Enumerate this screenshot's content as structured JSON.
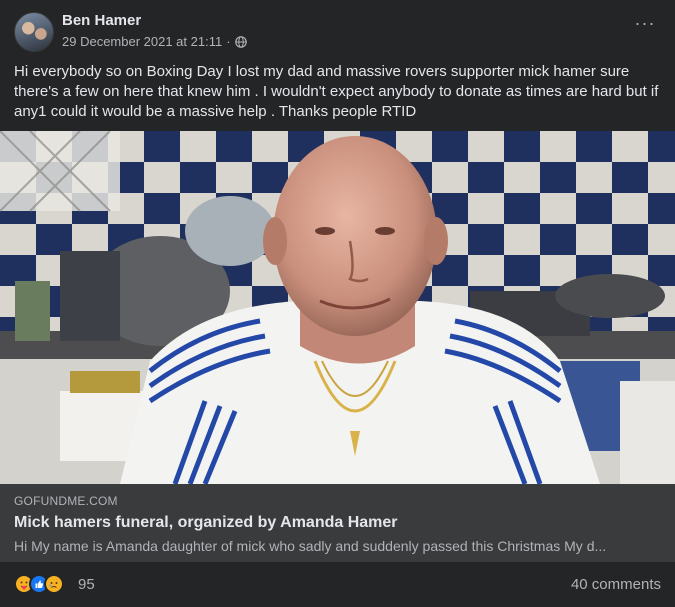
{
  "post": {
    "author": "Ben Hamer",
    "timestamp": "29 December 2021 at 21:11",
    "separator": "·",
    "privacy_icon": "globe-icon",
    "more_label": "···",
    "text": "Hi everybody so on Boxing Day I lost my dad and massive rovers supporter mick hamer sure there's a few on here that knew him . I wouldn't expect anybody to donate as times are hard but if any1 could it would be a massive help . Thanks people RTID"
  },
  "link_preview": {
    "domain": "GOFUNDME.COM",
    "title": "Mick hamers funeral, organized by Amanda Hamer",
    "description": "Hi My name is Amanda daughter of mick who sadly and suddenly passed this Christmas My d..."
  },
  "footer": {
    "reactions": [
      "care-icon",
      "like-icon",
      "sad-icon"
    ],
    "reaction_count": "95",
    "comments": "40 comments"
  },
  "colors": {
    "card_bg": "#242526",
    "link_bg": "#3a3b3c",
    "like_blue": "#1877f2",
    "reaction_yellow": "#f7b125"
  }
}
